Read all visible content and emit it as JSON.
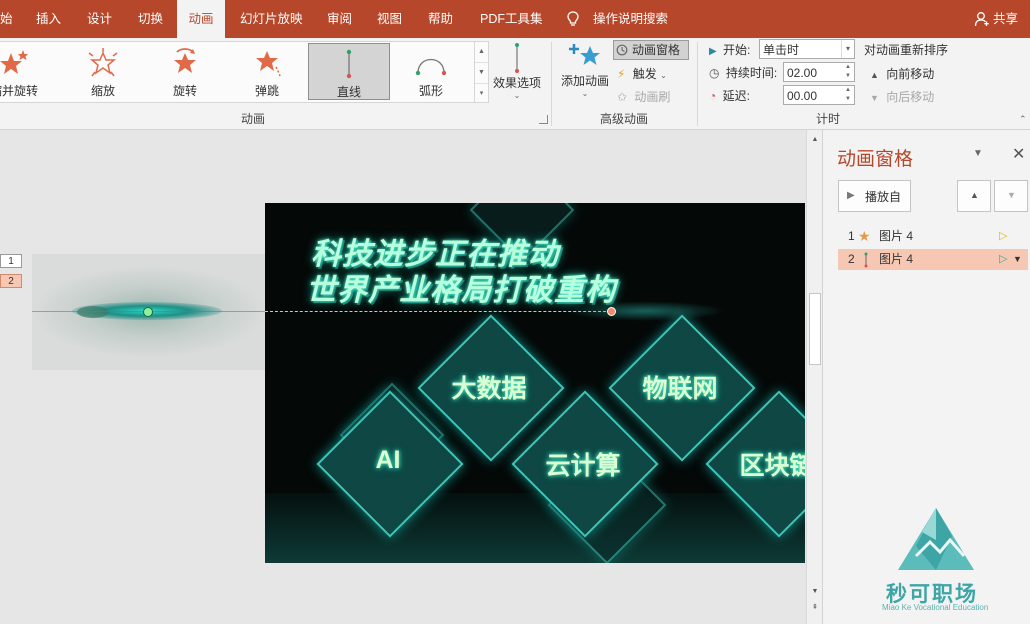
{
  "tabs": [
    "始",
    "插入",
    "设计",
    "切换",
    "动画",
    "幻灯片放映",
    "审阅",
    "视图",
    "帮助",
    "PDF工具集"
  ],
  "active_tab": "动画",
  "tell_me": "操作说明搜索",
  "share": "共享",
  "effects": [
    {
      "label": "缩并旋转",
      "icon": "shrink-turn-icon"
    },
    {
      "label": "缩放",
      "icon": "zoom-icon"
    },
    {
      "label": "旋转",
      "icon": "spin-icon"
    },
    {
      "label": "弹跳",
      "icon": "bounce-icon"
    },
    {
      "label": "直线",
      "icon": "line-path-icon",
      "selected": true
    },
    {
      "label": "弧形",
      "icon": "arc-path-icon"
    }
  ],
  "effect_options": "效果选项",
  "group_animation": "动画",
  "add_animation": "添加动画",
  "animation_pane_btn": "动画窗格",
  "trigger": "触发",
  "animation_painter": "动画刷",
  "group_advanced": "高级动画",
  "timing": {
    "start_label": "开始:",
    "start_value": "单击时",
    "duration_label": "持续时间:",
    "duration_value": "02.00",
    "delay_label": "延迟:",
    "delay_value": "00.00",
    "group": "计时"
  },
  "reorder": {
    "title": "对动画重新排序",
    "forward": "向前移动",
    "backward": "向后移动"
  },
  "slide_numbers": [
    "1",
    "2"
  ],
  "slide": {
    "title_line1": "科技进步正在推动",
    "title_line2": "世界产业格局打破重构",
    "labels": [
      "大数据",
      "物联网",
      "AI",
      "云计算",
      "区块链"
    ]
  },
  "pane": {
    "title": "动画窗格",
    "play_from": "播放自",
    "items": [
      {
        "num": "1",
        "name": "图片 4",
        "icon": "star-icon"
      },
      {
        "num": "2",
        "name": "图片 4",
        "icon": "line-path-icon",
        "selected": true
      }
    ]
  },
  "watermark": {
    "name": "秒可职场",
    "sub": "Miao Ke Vocational Education"
  },
  "colors": {
    "accent": "#b7472a",
    "slide_teal": "#3fc4b8",
    "selected_row": "#f6c8b4"
  }
}
